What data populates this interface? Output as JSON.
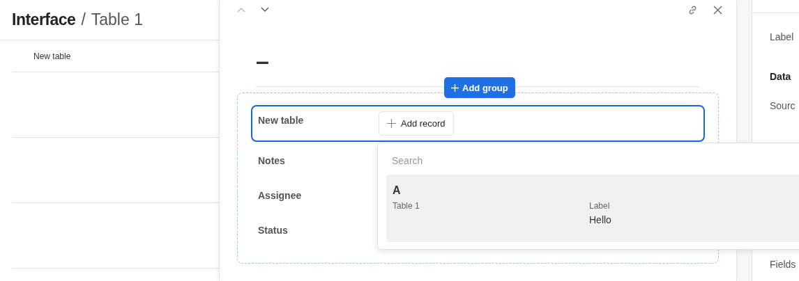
{
  "breadcrumb": {
    "app": "Interface",
    "separator": "/",
    "page": "Table 1"
  },
  "table": {
    "columns": [
      "New table"
    ]
  },
  "record": {
    "title": "–",
    "add_group": "Add group",
    "fields": [
      {
        "label": "New table",
        "selected": true,
        "kind": "link",
        "button": "Add record"
      },
      {
        "label": "Notes",
        "selected": false,
        "kind": "text"
      },
      {
        "label": "Assignee",
        "selected": false,
        "kind": "text"
      },
      {
        "label": "Status",
        "selected": false,
        "kind": "text"
      }
    ]
  },
  "popup": {
    "placeholder": "Search",
    "results": [
      {
        "title": "A",
        "table": "Table 1",
        "field_label": "Label",
        "field_value": "Hello",
        "selected": true
      }
    ]
  },
  "properties": {
    "items": [
      {
        "label": "Label",
        "kind": "field"
      },
      {
        "label": "Data",
        "kind": "heading"
      },
      {
        "label": "Sourc",
        "kind": "field"
      },
      {
        "label": "Fields",
        "kind": "field"
      }
    ]
  }
}
